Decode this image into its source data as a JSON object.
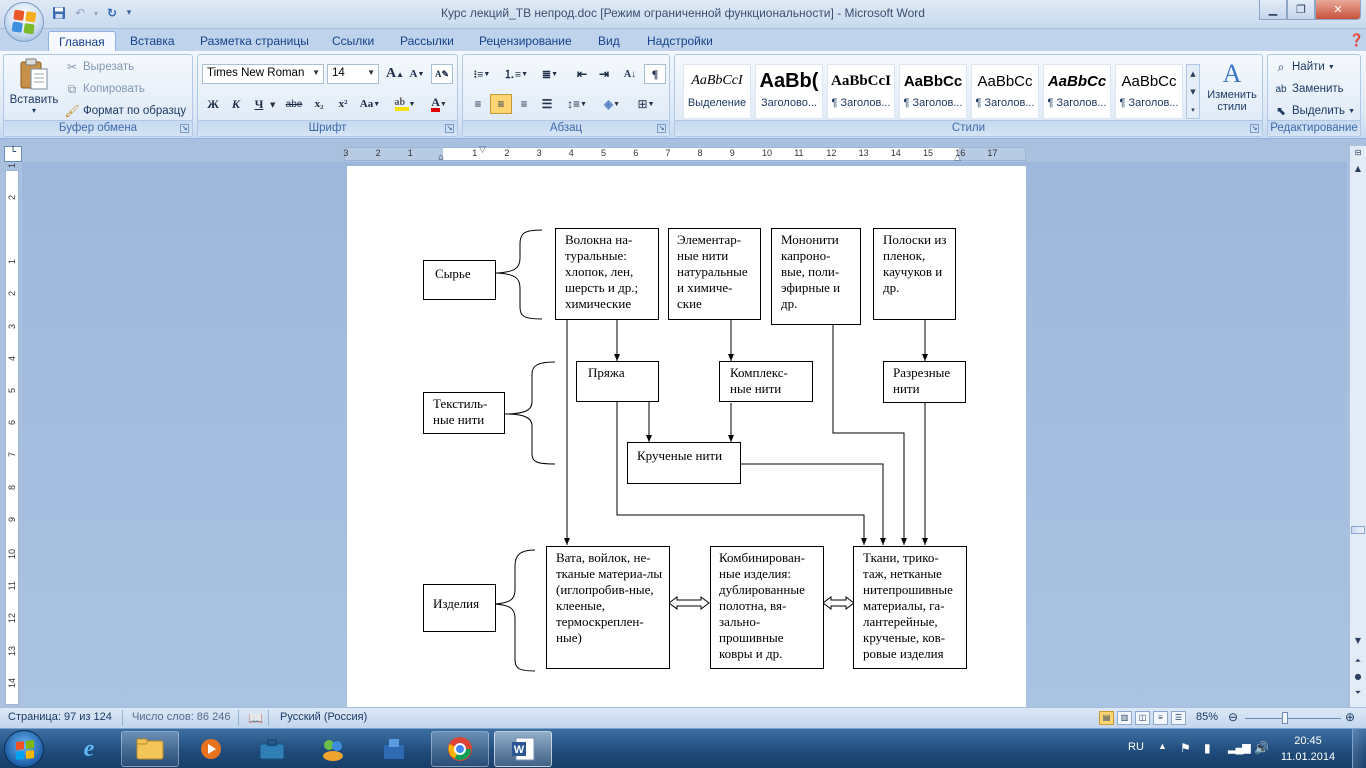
{
  "window": {
    "title": "Курс лекций_ТВ непрод.doc [Режим ограниченной функциональности] - Microsoft Word"
  },
  "ribbon_tabs": [
    "Главная",
    "Вставка",
    "Разметка страницы",
    "Ссылки",
    "Рассылки",
    "Рецензирование",
    "Вид",
    "Надстройки"
  ],
  "clipboard": {
    "group_label": "Буфер обмена",
    "paste": "Вставить",
    "cut": "Вырезать",
    "copy": "Копировать",
    "format_painter": "Формат по образцу"
  },
  "font": {
    "group_label": "Шрифт",
    "name": "Times New Roman",
    "size": "14",
    "bold": "Ж",
    "italic": "К",
    "underline": "Ч",
    "strike": "abe",
    "subscript": "x₂",
    "superscript": "x²",
    "case": "Aa",
    "grow": "A",
    "shrink": "A"
  },
  "paragraph": {
    "group_label": "Абзац"
  },
  "styles": {
    "group_label": "Стили",
    "items": [
      {
        "preview": "AaBbCcI",
        "name": "Выделение"
      },
      {
        "preview": "AaBb(",
        "name": "Заголово..."
      },
      {
        "preview": "AaBbCcI",
        "name": "¶ Заголов..."
      },
      {
        "preview": "AaBbCc",
        "name": "¶ Заголов..."
      },
      {
        "preview": "AaBbCc",
        "name": "¶ Заголов..."
      },
      {
        "preview": "AaBbCc",
        "name": "¶ Заголов..."
      },
      {
        "preview": "AaBbCc",
        "name": "¶ Заголов..."
      }
    ],
    "change_styles": "Изменить стили"
  },
  "editing": {
    "group_label": "Редактирование",
    "find": "Найти",
    "replace": "Заменить",
    "select": "Выделить"
  },
  "ruler": {
    "numbers": [
      "3",
      "2",
      "1",
      "1",
      "2",
      "3",
      "4",
      "5",
      "6",
      "7",
      "8",
      "9",
      "10",
      "11",
      "12",
      "13",
      "14",
      "15",
      "16",
      "17"
    ],
    "vnumbers": [
      "1",
      "2",
      "1",
      "2",
      "3",
      "4",
      "5",
      "6",
      "7",
      "8",
      "9",
      "10",
      "11",
      "12",
      "13",
      "14"
    ]
  },
  "diagram": {
    "syrye": "Сырье",
    "tekstil": "Текстиль-ные нити",
    "izdeliya": "Изделия",
    "volokna": "Волокна на-туральные: хлопок, лен, шерсть и др.; химические",
    "elementar": "Элементар-ные нити натуральные и химиче-ские",
    "mononiti": "Мононити капроно-вые, поли-эфирные и др.",
    "poloski": "Полоски из пленок, каучуков и др.",
    "pryazha": "Пряжа",
    "kompleks": "Комплекс-ные нити",
    "razreznye": "Разрезные нити",
    "kruchenye": "Крученые нити",
    "vata": "Вата, войлок, не-тканые материа-лы (иглопробив-ные, клееные, термоскреплен-ные)",
    "kombinir": "Комбинирован-ные изделия: дублированные полотна, вя-зально-прошивные ковры и др.",
    "tkani": "Ткани, трико-таж, нетканые нитепрошивные материалы, га-лантерейные, крученые, ков-ровые изделия"
  },
  "status": {
    "page": "Страница: 97 из 124",
    "words": "Число слов: 86 246",
    "language": "Русский (Россия)",
    "zoom": "85%",
    "zoom_level": 0.85
  },
  "taskbar": {
    "lang": "RU",
    "time": "20:45",
    "date": "11.01.2014"
  }
}
